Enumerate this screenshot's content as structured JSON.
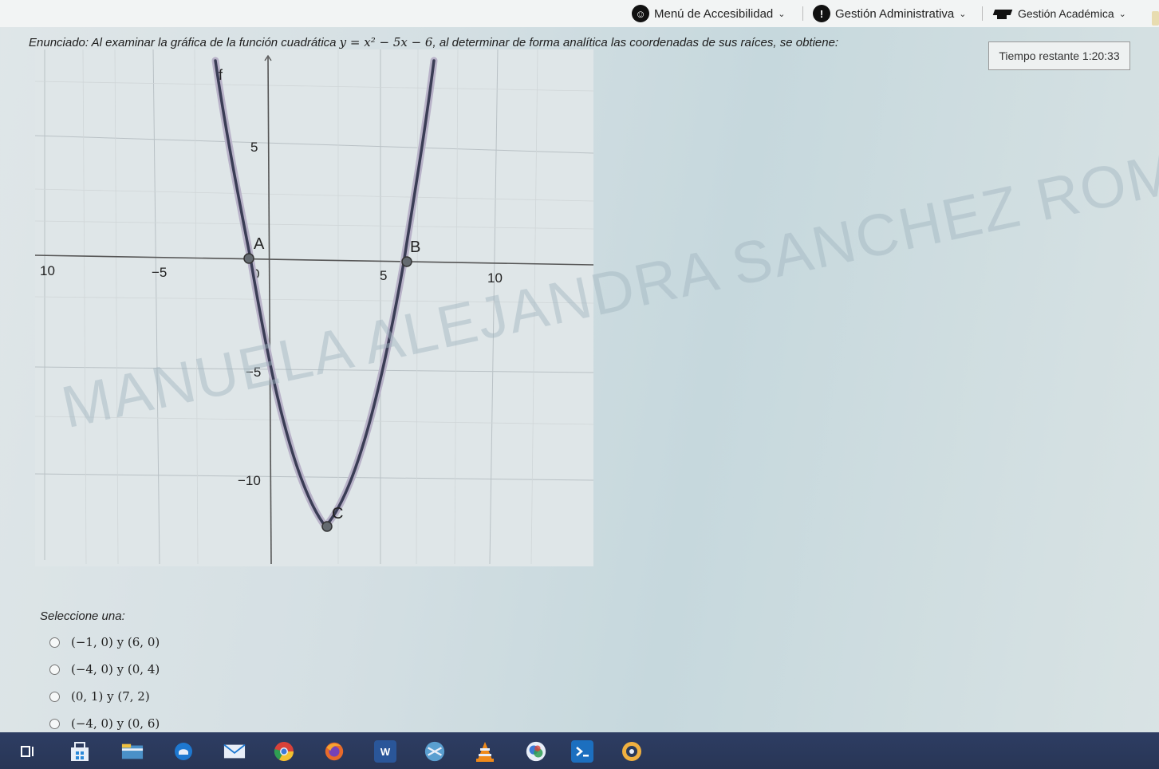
{
  "topbar": {
    "accessibility_label": "Menú de Accesibilidad",
    "admin_label": "Gestión Administrativa",
    "academic_label": "Gestión Académica"
  },
  "question": {
    "prefix": "Enunciado: Al examinar la gráfica de la función cuadrática ",
    "formula": "y = x² − 5x − 6",
    "suffix": ", al determinar de forma analítica las coordenadas de sus raíces, se obtiene:"
  },
  "timer": {
    "label": "Tiempo restante 1:20:33"
  },
  "graph": {
    "func_label": "f",
    "point_labels": [
      "A",
      "B",
      "C"
    ],
    "x_ticks": [
      "10",
      "−5",
      "0",
      "5",
      "10"
    ],
    "y_ticks": [
      "5",
      "−5",
      "−10"
    ]
  },
  "watermark": "MANUELA ALEJANDRA SANCHEZ ROMERO",
  "select_label": "Seleccione una:",
  "options": [
    "(−1, 0)  y  (6, 0)",
    "(−4, 0)  y  (0, 4)",
    "(0, 1)  y  (7, 2)",
    "(−4, 0)  y  (0, 6)"
  ],
  "taskbar": {
    "icons": [
      "taskview-icon",
      "store-icon",
      "files-icon",
      "edge-icon",
      "mail-icon",
      "chrome-icon",
      "firefox-icon",
      "word-icon",
      "app-icon",
      "vlc-icon",
      "photos-icon",
      "terminal-icon",
      "extra-icon"
    ],
    "word_glyph": "W"
  },
  "colors": {
    "curve": "#3a3d55",
    "curve_halo": "#b8b2c8",
    "point": "#646a70",
    "taskbar": "#2e3d63"
  }
}
